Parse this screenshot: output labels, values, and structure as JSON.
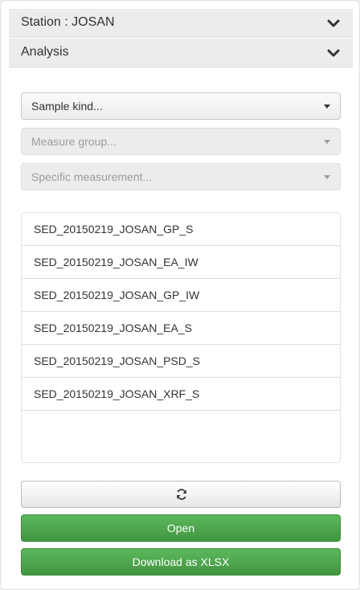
{
  "accordion": {
    "station_label": "Station : JOSAN",
    "analysis_label": "Analysis"
  },
  "filters": {
    "sample_kind": "Sample kind...",
    "measure_group": "Measure group...",
    "specific_measurement": "Specific measurement..."
  },
  "files": [
    "SED_20150219_JOSAN_GP_S",
    "SED_20150219_JOSAN_EA_IW",
    "SED_20150219_JOSAN_GP_IW",
    "SED_20150219_JOSAN_EA_S",
    "SED_20150219_JOSAN_PSD_S",
    "SED_20150219_JOSAN_XRF_S"
  ],
  "actions": {
    "refresh_icon": "refresh-icon",
    "open_label": "Open",
    "download_label": "Download as XLSX"
  },
  "colors": {
    "accordion_bg": "#ececec",
    "primary_green": "#4cae4c",
    "text": "#333333"
  }
}
